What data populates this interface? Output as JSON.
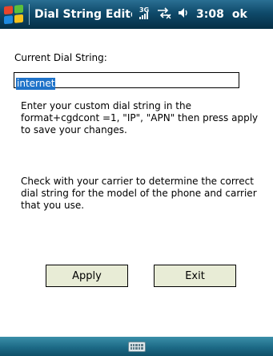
{
  "titlebar": {
    "title": "Dial String Editc",
    "network_label": "3G",
    "time": "3:08",
    "ok_label": "ok"
  },
  "form": {
    "current_label": "Current Dial String:",
    "dial_string_value": "internet"
  },
  "instructions": {
    "paragraph1": "Enter your custom dial string in the format+cgdcont =1, \"IP\", \"APN\" then press apply to save your changes.",
    "paragraph2": "Check with your carrier to determine the correct dial string for the model of the phone and carrier that you use."
  },
  "buttons": {
    "apply": "Apply",
    "exit": "Exit"
  },
  "colors": {
    "selection": "#1f73c9",
    "button_bg": "#e8ecd6"
  },
  "icons": {
    "start": "windows-flag-icon",
    "signal": "signal-3g-icon",
    "connectivity": "connectivity-icon",
    "volume": "speaker-icon",
    "keyboard": "keyboard-icon"
  }
}
